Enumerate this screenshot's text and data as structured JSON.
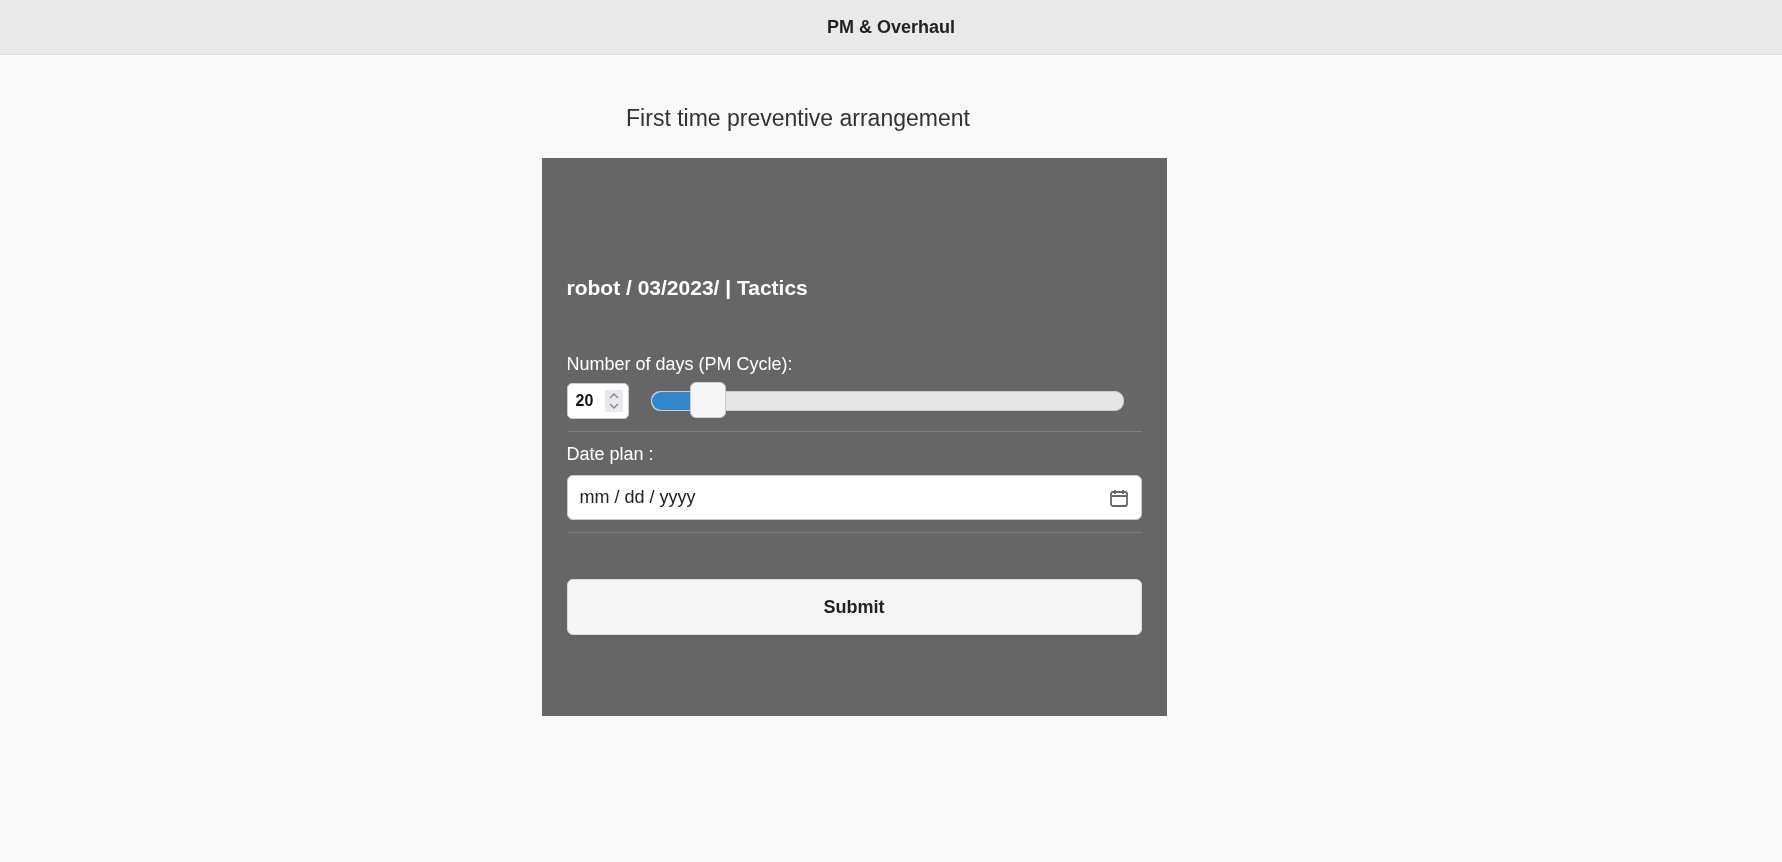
{
  "header": {
    "title": "PM & Overhaul"
  },
  "page_title": "First time preventive arrangement",
  "form": {
    "heading": "robot / 03/2023/ | Tactics",
    "days": {
      "label": "Number of days (PM Cycle):",
      "value": "20",
      "level": 0.12
    },
    "date": {
      "label": "Date plan :",
      "placeholder": "mm / dd / yyyy"
    },
    "submit": "Submit"
  }
}
